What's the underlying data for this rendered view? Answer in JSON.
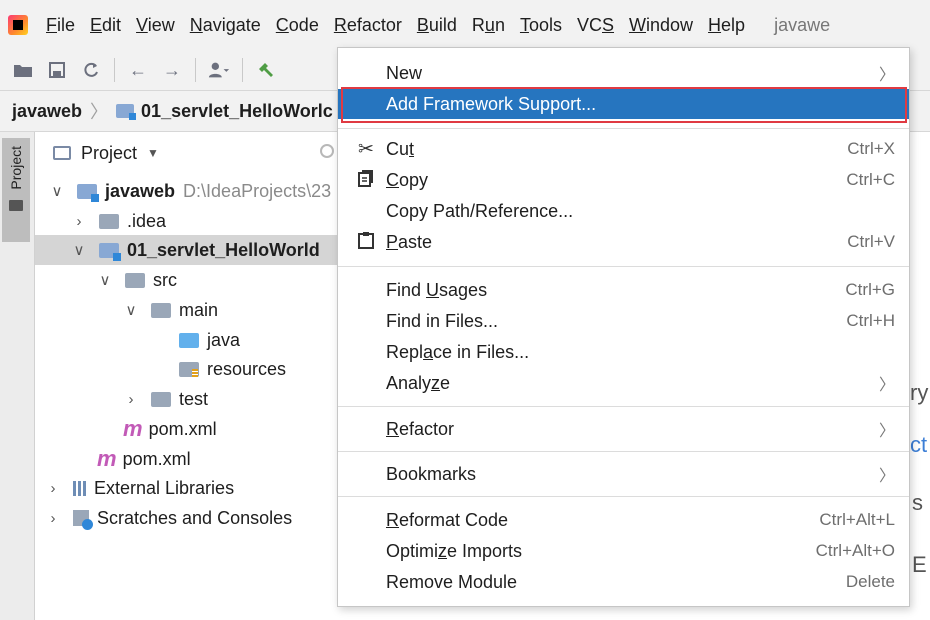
{
  "menubar": {
    "items": [
      {
        "pre": "",
        "u": "F",
        "post": "ile"
      },
      {
        "pre": "",
        "u": "E",
        "post": "dit"
      },
      {
        "pre": "",
        "u": "V",
        "post": "iew"
      },
      {
        "pre": "",
        "u": "N",
        "post": "avigate"
      },
      {
        "pre": "",
        "u": "C",
        "post": "ode"
      },
      {
        "pre": "",
        "u": "R",
        "post": "efactor"
      },
      {
        "pre": "",
        "u": "B",
        "post": "uild"
      },
      {
        "pre": "R",
        "u": "u",
        "post": "n"
      },
      {
        "pre": "",
        "u": "T",
        "post": "ools"
      },
      {
        "pre": "VC",
        "u": "S",
        "post": ""
      },
      {
        "pre": "",
        "u": "W",
        "post": "indow"
      },
      {
        "pre": "",
        "u": "H",
        "post": "elp"
      }
    ],
    "window_title": "javawe"
  },
  "breadcrumb": {
    "project": "javaweb",
    "module": "01_servlet_HelloWorlc"
  },
  "tool_strip": {
    "project_tab": "Project"
  },
  "project_panel": {
    "title": "Project",
    "tree": [
      {
        "label": "javaweb",
        "path": "D:\\IdeaProjects\\23"
      },
      {
        "label": ".idea"
      },
      {
        "label": "01_servlet_HelloWorld"
      },
      {
        "label": "src"
      },
      {
        "label": "main"
      },
      {
        "label": "java"
      },
      {
        "label": "resources"
      },
      {
        "label": "test"
      },
      {
        "label": "pom.xml"
      },
      {
        "label": "pom.xml"
      },
      {
        "label": "External Libraries"
      },
      {
        "label": "Scratches and Consoles"
      }
    ],
    "maven_glyph": "m"
  },
  "editor_ghost": [
    "ry",
    "ct",
    "s",
    "E"
  ],
  "context_menu": {
    "new": "New",
    "add_framework": "Add Framework Support...",
    "cut": {
      "pre": "Cu",
      "u": "t",
      "post": "",
      "shortcut": "Ctrl+X"
    },
    "copy": {
      "pre": "",
      "u": "C",
      "post": "opy",
      "shortcut": "Ctrl+C"
    },
    "copy_path": "Copy Path/Reference...",
    "paste": {
      "pre": "",
      "u": "P",
      "post": "aste",
      "shortcut": "Ctrl+V"
    },
    "find_usages": {
      "pre": "Find ",
      "u": "U",
      "post": "sages",
      "shortcut": "Ctrl+G"
    },
    "find_in_files": {
      "label": "Find in Files...",
      "shortcut": "Ctrl+H"
    },
    "replace_in_files": {
      "pre": "Repl",
      "u": "a",
      "post": "ce in Files..."
    },
    "analyze": {
      "pre": "Analy",
      "u": "z",
      "post": "e"
    },
    "refactor": {
      "pre": "",
      "u": "R",
      "post": "efactor"
    },
    "bookmarks": "Bookmarks",
    "reformat": {
      "pre": "",
      "u": "R",
      "post": "eformat Code",
      "shortcut": "Ctrl+Alt+L"
    },
    "optimize": {
      "pre": "Optimi",
      "u": "z",
      "post": "e Imports",
      "shortcut": "Ctrl+Alt+O"
    },
    "remove_module": {
      "label": "Remove Module",
      "shortcut": "Delete"
    }
  },
  "colors": {
    "selection": "#2675bf",
    "highlight_outline": "#e03a42",
    "tree_selected": "#d5d5d5"
  }
}
